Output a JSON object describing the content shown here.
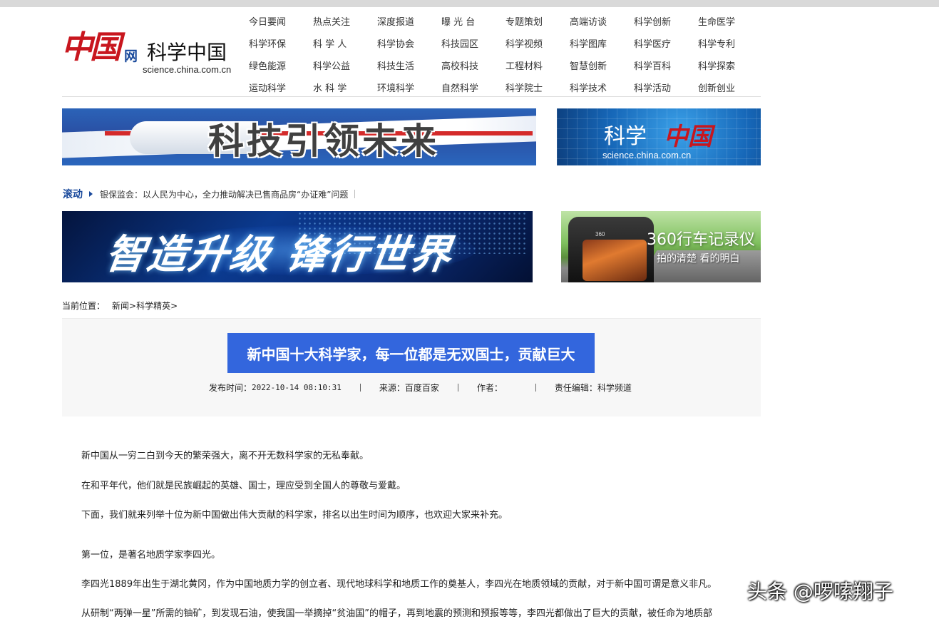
{
  "header": {
    "logo_zh": "中国",
    "logo_wang": "网",
    "logo_site": "科学中国",
    "logo_domain": "science.china.com.cn",
    "nav_rows": [
      [
        "今日要闻",
        "热点关注",
        "深度报道",
        "曝 光 台",
        "专题策划",
        "高端访谈",
        "科学创新",
        "生命医学"
      ],
      [
        "科学环保",
        "科 学 人",
        "科学协会",
        "科技园区",
        "科学视频",
        "科学图库",
        "科学医疗",
        "科学专利"
      ],
      [
        "绿色能源",
        "科学公益",
        "科技生活",
        "高校科技",
        "工程材料",
        "智慧创新",
        "科学百科",
        "科学探索"
      ],
      [
        "运动科学",
        "水 科 学",
        "环境科学",
        "自然科学",
        "科学院士",
        "科学技术",
        "科学活动",
        "创新创业"
      ]
    ]
  },
  "banners": {
    "b1_text": "科技引领未来",
    "b2_text1": "科学",
    "b2_text2": "中国",
    "b2_domain": "science.china.com.cn",
    "b3_text": "智造升级 锋行世界",
    "b4_logo": "360",
    "b4_title": "360行车记录仪",
    "b4_sub": "拍的清楚 看的明白"
  },
  "scroll": {
    "label": "滚动",
    "news": "银保监会：以人民为中心，全力推动解决已售商品房“办证难”问题"
  },
  "breadcrumb": {
    "label": "当前位置：",
    "path": "新闻>科学精英>"
  },
  "article": {
    "title": "新中国十大科学家，每一位都是无双国士，贡献巨大",
    "publish_label": "发布时间：",
    "publish_time": "2022-10-14 08:10:31",
    "source_label": "来源：",
    "source": "百度百家",
    "author_label": "作者：",
    "author": "",
    "editor_label": "责任编辑：",
    "editor": "科学频道",
    "paragraphs": [
      "新中国从一穷二白到今天的繁荣强大，离不开无数科学家的无私奉献。",
      "在和平年代，他们就是民族崛起的英雄、国士，理应受到全国人的尊敬与爱戴。",
      "下面，我们就来列举十位为新中国做出伟大贡献的科学家，排名以出生时间为顺序，也欢迎大家来补充。",
      "第一位，是著名地质学家李四光。",
      "李四光1889年出生于湖北黄冈，作为中国地质力学的创立者、现代地球科学和地质工作的奠基人，李四光在地质领域的贡献，对于新中国可谓是意义非凡。",
      "从研制“两弹一星”所需的铀矿，到发现石油，使我国一举摘掉“贫油国”的帽子，再到地震的预测和预报等等，李四光都做出了巨大的贡献，被任命为地质部"
    ]
  },
  "watermark": "头条 @啰嗦翔子"
}
